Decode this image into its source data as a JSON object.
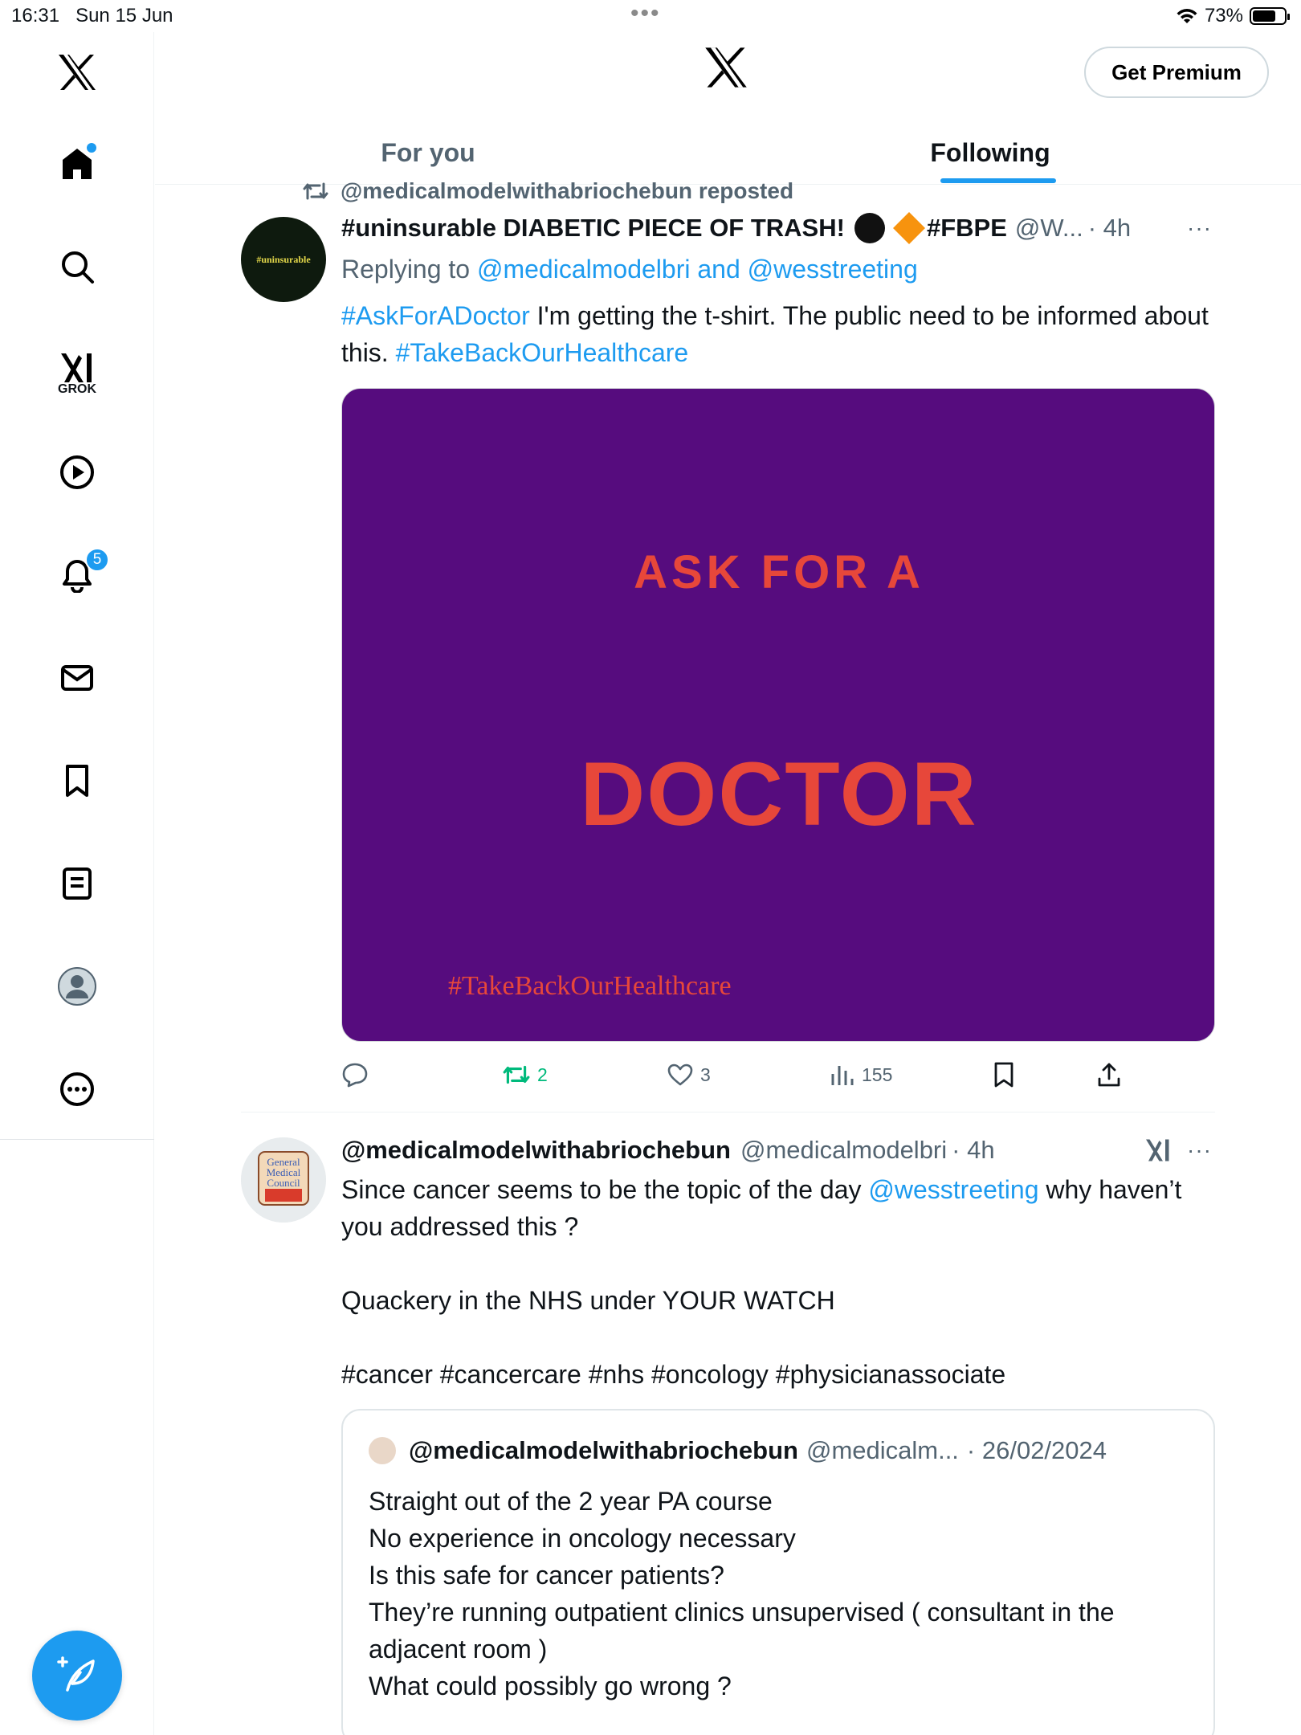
{
  "status_bar": {
    "time": "16:31",
    "date": "Sun 15 Jun",
    "battery": "73%"
  },
  "sidebar": {
    "items": [
      {
        "name": "home",
        "icon": "home-icon"
      },
      {
        "name": "explore",
        "icon": "search-icon"
      },
      {
        "name": "grok",
        "icon": "grok-icon",
        "label": "GROK"
      },
      {
        "name": "videos",
        "icon": "play-icon"
      },
      {
        "name": "notifications",
        "icon": "bell-icon",
        "badge": "5"
      },
      {
        "name": "messages",
        "icon": "mail-icon"
      },
      {
        "name": "bookmarks",
        "icon": "bookmark-icon"
      },
      {
        "name": "articles",
        "icon": "article-icon"
      },
      {
        "name": "profile",
        "icon": "avatar-icon"
      },
      {
        "name": "more",
        "icon": "more-circle-icon"
      }
    ],
    "compose": "compose-icon"
  },
  "header": {
    "premium_label": "Get Premium",
    "tabs": [
      {
        "label": "For you"
      },
      {
        "label": "Following"
      }
    ]
  },
  "tweet1": {
    "repost_text": "@medicalmodelwithabriochebun reposted",
    "name": "#uninsurable DIABETIC PIECE OF TRASH!",
    "name_tag": "#FBPE",
    "handle": "@W...",
    "time": "· 4h",
    "avatar_text": "#uninsurable",
    "reply_prefix": "Replying to",
    "reply_to": "@medicalmodelbri and @wesstreeting",
    "text_tag1": "#AskForADoctor",
    "text_body": " I'm getting the t-shirt. The public need to be informed about this. ",
    "text_tag2": "#TakeBackOurHealthcare",
    "media": {
      "line1": "ASK  FOR  A",
      "line2": "DOCTOR",
      "tag": "#TakeBackOurHealthcare",
      "background": "#560c7e",
      "text_color": "#e7473a"
    },
    "actions": {
      "replies": "",
      "reposts": "2",
      "likes": "3",
      "views": "155"
    }
  },
  "tweet2": {
    "name": "@medicalmodelwithabriochebun",
    "handle": "@medicalmodelbri",
    "time": "· 4h",
    "text_a": "Since cancer seems to be the topic of the day ",
    "mention": "@wesstreeting",
    "text_b": " why haven’t you addressed this ?",
    "text_c": "Quackery in the NHS under YOUR WATCH",
    "hashtags": "#cancer #cancercare #nhs #oncology #physicianassociate",
    "avatar_lines": [
      "General",
      "Medical",
      "Council"
    ],
    "quote": {
      "name": "@medicalmodelwithabriochebun",
      "handle": "@medicalm...",
      "date": "· 26/02/2024",
      "lines": [
        "Straight  out of the 2 year PA course",
        "No experience in oncology necessary",
        "Is this safe for cancer patients?",
        "They’re running outpatient clinics unsupervised ( consultant in the adjacent room )",
        "What could possibly go wrong ?"
      ]
    }
  },
  "colors": {
    "accent": "#1d9bf0",
    "repost_green": "#00ba7c",
    "muted": "#536471"
  }
}
